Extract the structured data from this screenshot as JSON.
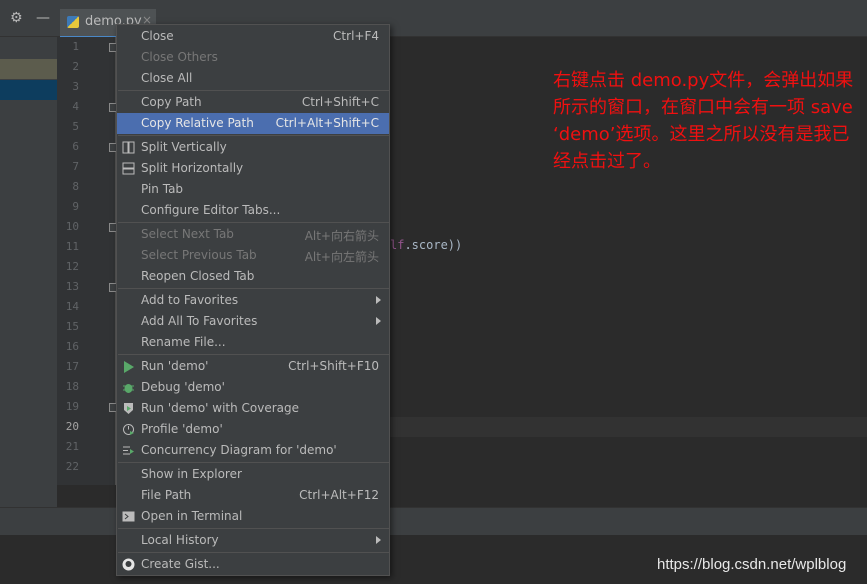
{
  "tab": {
    "label": "demo.py",
    "close": "×"
  },
  "toolbar": {
    "settings_icon": "⚙",
    "minimize_icon": "—"
  },
  "line_numbers": [
    "1",
    "2",
    "3",
    "4",
    "5",
    "6",
    "7",
    "8",
    "9",
    "10",
    "11",
    "12",
    "13",
    "14",
    "15",
    "16",
    "17",
    "18",
    "19",
    "20",
    "21",
    "22"
  ],
  "current_line": "20",
  "code_fragment": {
    "keyword": "lf",
    "rest": ".score))"
  },
  "annotation": "右键点击 demo.py文件，会弹出如果所示的窗口，在窗口中会有一项 save ‘demo’选项。这里之所以没有是我已经点击过了。",
  "watermark": "https://blog.csdn.net/wplblog",
  "menu": [
    {
      "label": "Close",
      "shortcut": "Ctrl+F4"
    },
    {
      "label": "Close Others",
      "disabled": true
    },
    {
      "label": "Close All"
    },
    {
      "sep": true
    },
    {
      "label": "Copy Path",
      "shortcut": "Ctrl+Shift+C"
    },
    {
      "label": "Copy Relative Path",
      "shortcut": "Ctrl+Alt+Shift+C",
      "selected": true
    },
    {
      "sep": true
    },
    {
      "label": "Split Vertically",
      "icon": "split-vertical-icon"
    },
    {
      "label": "Split Horizontally",
      "icon": "split-horizontal-icon"
    },
    {
      "label": "Pin Tab"
    },
    {
      "label": "Configure Editor Tabs..."
    },
    {
      "sep": true
    },
    {
      "label": "Select Next Tab",
      "shortcut": "Alt+向右箭头",
      "disabled": true
    },
    {
      "label": "Select Previous Tab",
      "shortcut": "Alt+向左箭头",
      "disabled": true
    },
    {
      "label": "Reopen Closed Tab"
    },
    {
      "sep": true
    },
    {
      "label": "Add to Favorites",
      "submenu": true
    },
    {
      "label": "Add All To Favorites",
      "submenu": true
    },
    {
      "label": "Rename File..."
    },
    {
      "sep": true
    },
    {
      "label": "Run 'demo'",
      "shortcut": "Ctrl+Shift+F10",
      "icon": "run-icon"
    },
    {
      "label": "Debug 'demo'",
      "icon": "debug-icon"
    },
    {
      "label": "Run 'demo' with Coverage",
      "icon": "coverage-icon"
    },
    {
      "label": "Profile 'demo'",
      "icon": "profile-icon"
    },
    {
      "label": "Concurrency Diagram for 'demo'",
      "icon": "concurrency-icon"
    },
    {
      "sep": true
    },
    {
      "label": "Show in Explorer"
    },
    {
      "label": "File Path",
      "shortcut": "Ctrl+Alt+F12"
    },
    {
      "label": "Open in Terminal",
      "icon": "terminal-icon"
    },
    {
      "sep": true
    },
    {
      "label": "Local History",
      "submenu": true
    },
    {
      "sep": true
    },
    {
      "label": "Create Gist...",
      "icon": "github-icon"
    }
  ],
  "colors": {
    "selection": "#4b6eaf",
    "annotation": "#f01010",
    "run_green": "#59a869"
  }
}
